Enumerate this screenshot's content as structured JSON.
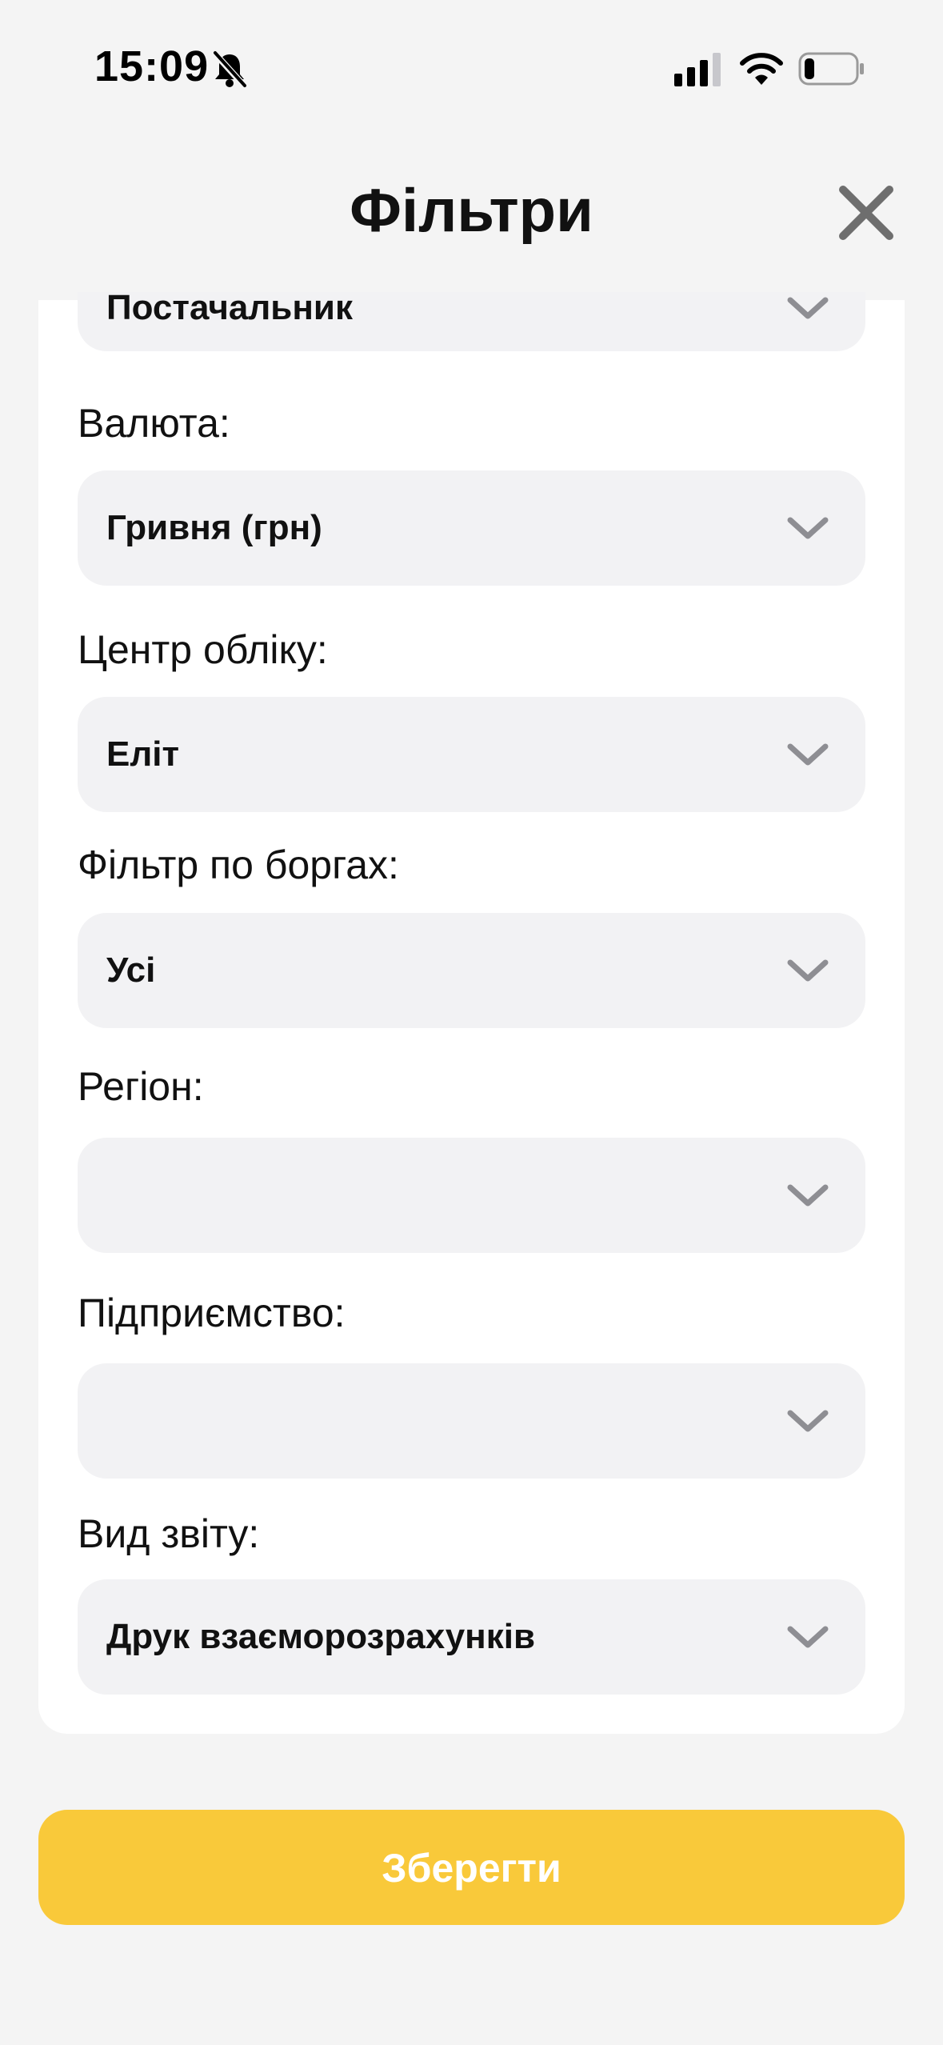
{
  "status_bar": {
    "time": "15:09",
    "icons": [
      "bell-slash-icon",
      "signal-icon",
      "wifi-icon",
      "battery-icon"
    ],
    "battery_level": 0.2
  },
  "header": {
    "title": "Фільтри",
    "close_icon": "close-icon"
  },
  "filters": {
    "supplier": {
      "value": "Постачальник"
    },
    "currency": {
      "label": "Валюта:",
      "value": "Гривня (грн)"
    },
    "accounting_center": {
      "label": "Центр обліку:",
      "value": "Еліт"
    },
    "debt_filter": {
      "label": "Фільтр по боргах:",
      "value": "Усі"
    },
    "region": {
      "label": "Регіон:",
      "value": ""
    },
    "enterprise": {
      "label": "Підприємство:",
      "value": ""
    },
    "report_type": {
      "label": "Вид звіту:",
      "value": "Друк взаєморозрахунків"
    }
  },
  "save_button": {
    "label": "Зберегти"
  },
  "colors": {
    "accent": "#f9c93a",
    "background": "#f4f4f4",
    "card": "#ffffff",
    "field": "#f2f2f4",
    "chevron": "#8e8e93"
  }
}
